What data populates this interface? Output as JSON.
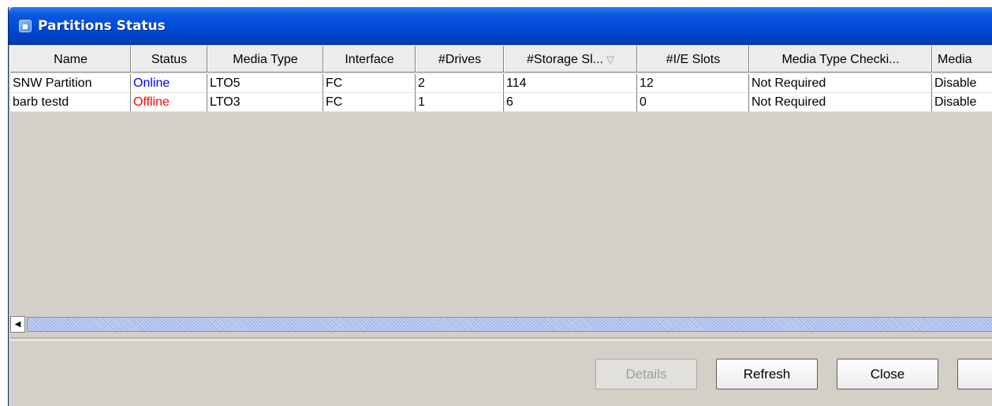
{
  "window": {
    "title": "Partitions Status",
    "icon": "app-icon"
  },
  "table": {
    "columns": [
      {
        "label": "Name"
      },
      {
        "label": "Status"
      },
      {
        "label": "Media Type"
      },
      {
        "label": "Interface"
      },
      {
        "label": "#Drives"
      },
      {
        "label": "#Storage Sl...",
        "sorted": true,
        "sort_icon": "▽"
      },
      {
        "label": "#I/E Slots"
      },
      {
        "label": "Media Type Checki..."
      },
      {
        "label": "Media"
      }
    ],
    "rows": [
      {
        "cells": [
          "SNW Partition",
          "Online",
          "LTO5",
          "FC",
          "2",
          "114",
          "12",
          "Not Required",
          "Disable"
        ],
        "status_color": "#0000ff"
      },
      {
        "cells": [
          "barb testd",
          "Offline",
          "LTO3",
          "FC",
          "1",
          "6",
          "0",
          "Not Required",
          "Disable"
        ],
        "status_color": "#ff0000"
      }
    ]
  },
  "buttons": {
    "details": "Details",
    "refresh": "Refresh",
    "close": "Close"
  },
  "colors": {
    "online": "#0000ff",
    "offline": "#ff0000",
    "title_bar": "#0049d6"
  }
}
